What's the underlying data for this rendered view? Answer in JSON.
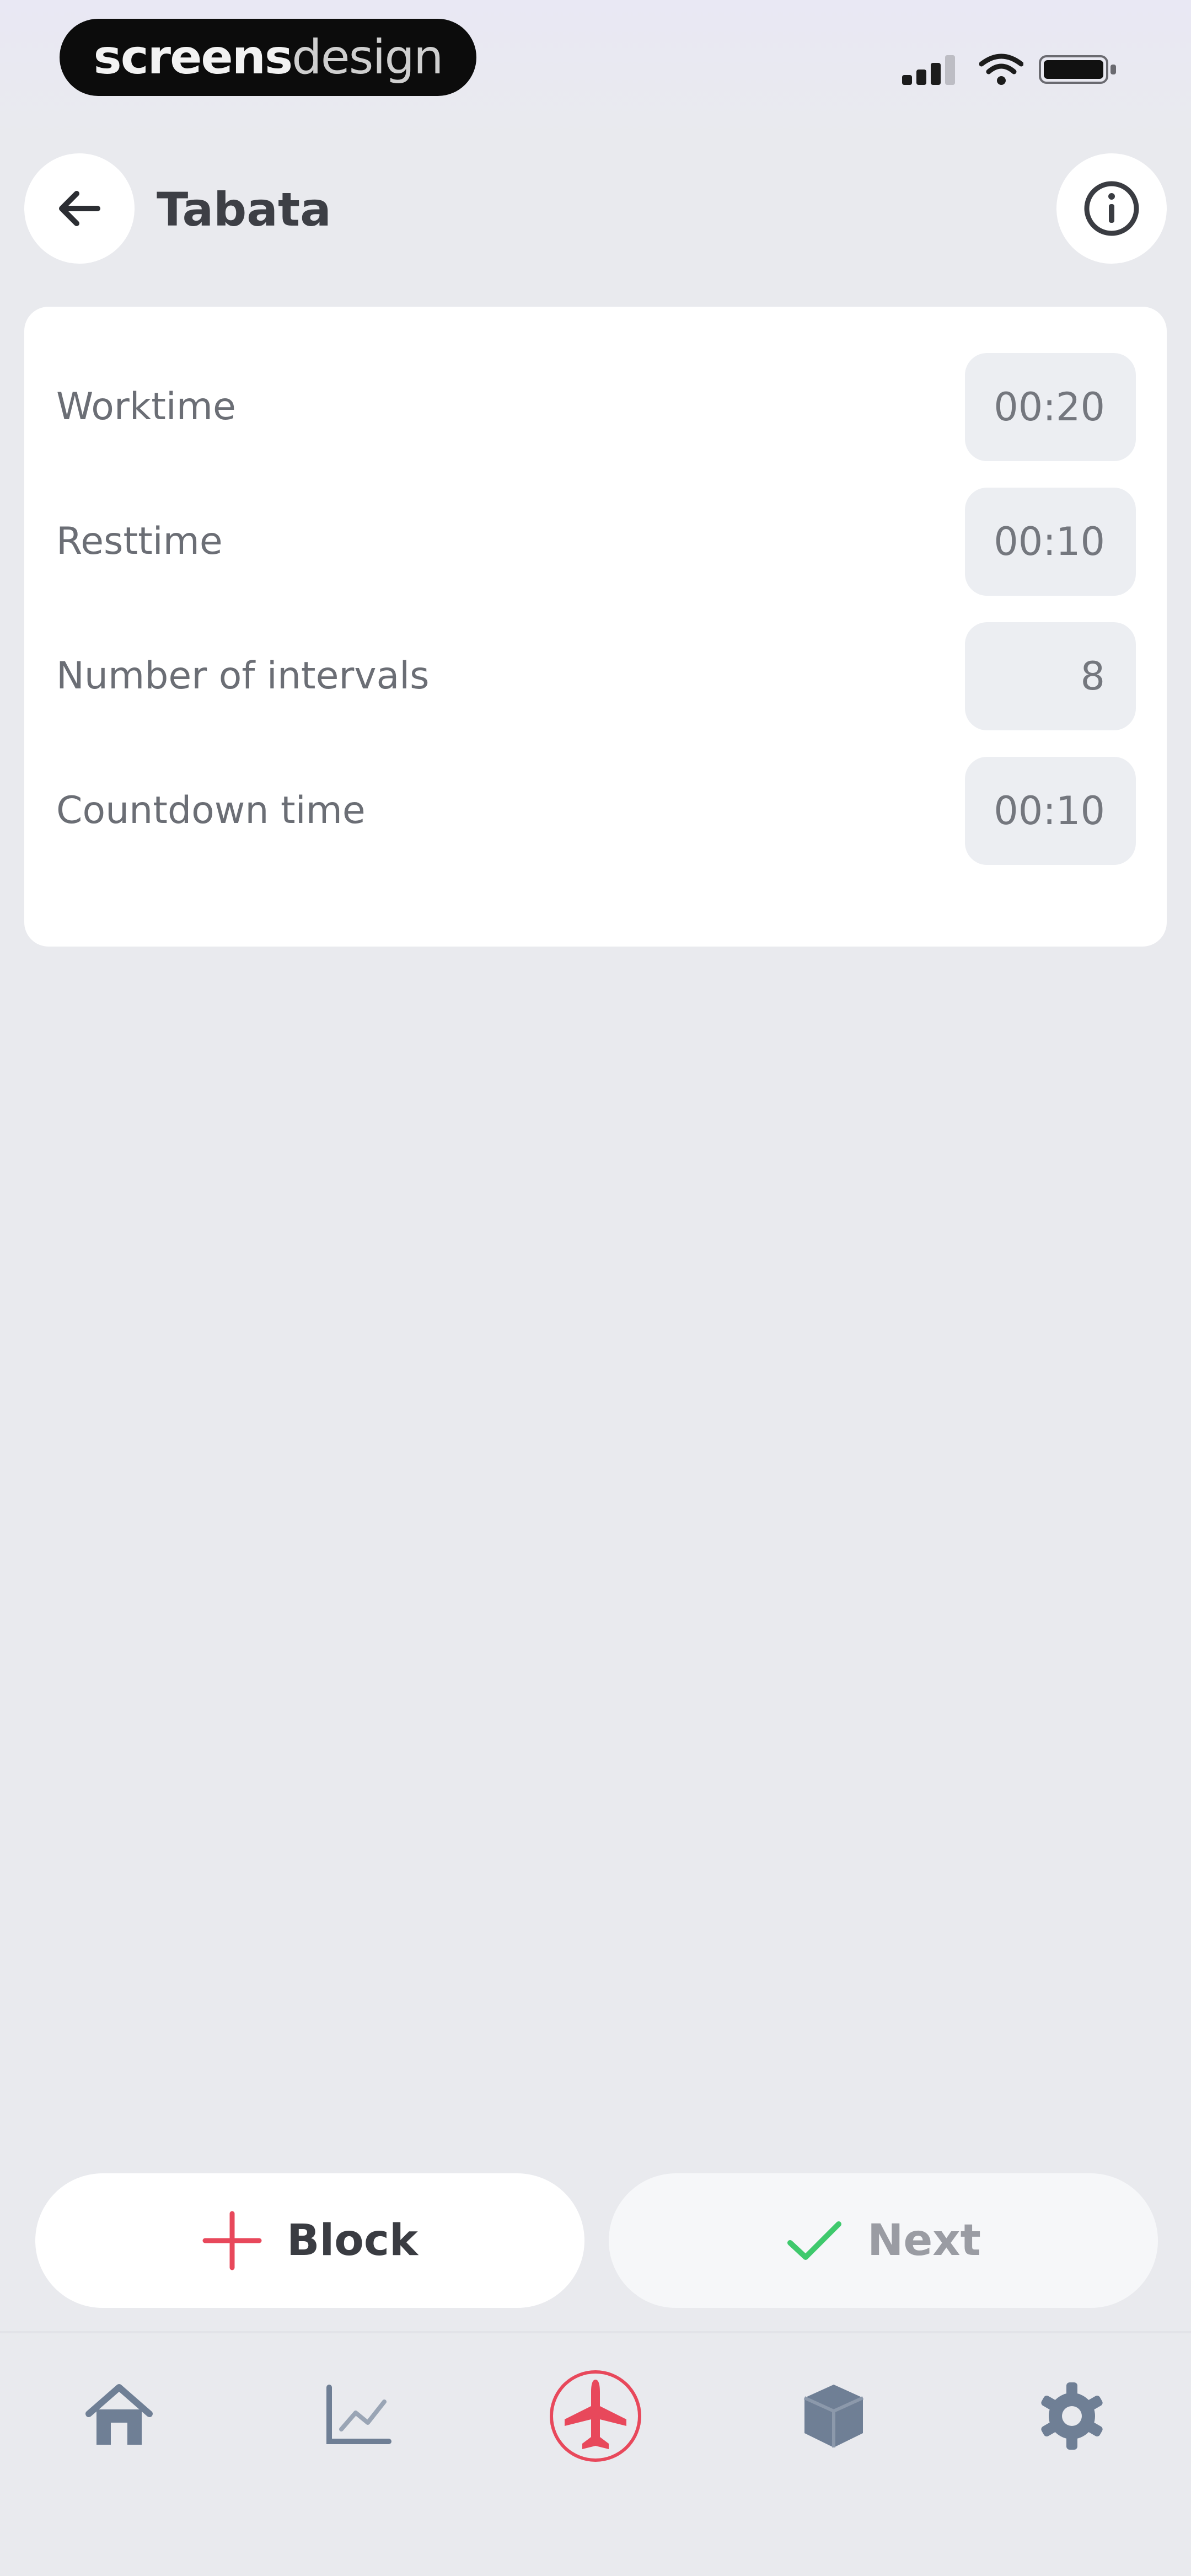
{
  "status_bar": {
    "brand_bold": "screens",
    "brand_light": "design"
  },
  "header": {
    "title": "Tabata"
  },
  "settings": [
    {
      "label": "Worktime",
      "value": "00:20"
    },
    {
      "label": "Resttime",
      "value": "00:10"
    },
    {
      "label": "Number of intervals",
      "value": "8"
    },
    {
      "label": "Countdown time",
      "value": "00:10"
    }
  ],
  "actions": {
    "block_label": "Block",
    "next_label": "Next"
  },
  "colors": {
    "accent_red": "#e8485b",
    "check_green": "#3fc96d",
    "icon_gray": "#6f7f95"
  },
  "icons": {
    "back": "arrow-left-icon",
    "info": "info-icon",
    "add": "plus-icon",
    "confirm": "check-icon",
    "tabs": [
      "home-icon",
      "chart-icon",
      "airplane-icon",
      "cube-icon",
      "gear-icon"
    ]
  }
}
